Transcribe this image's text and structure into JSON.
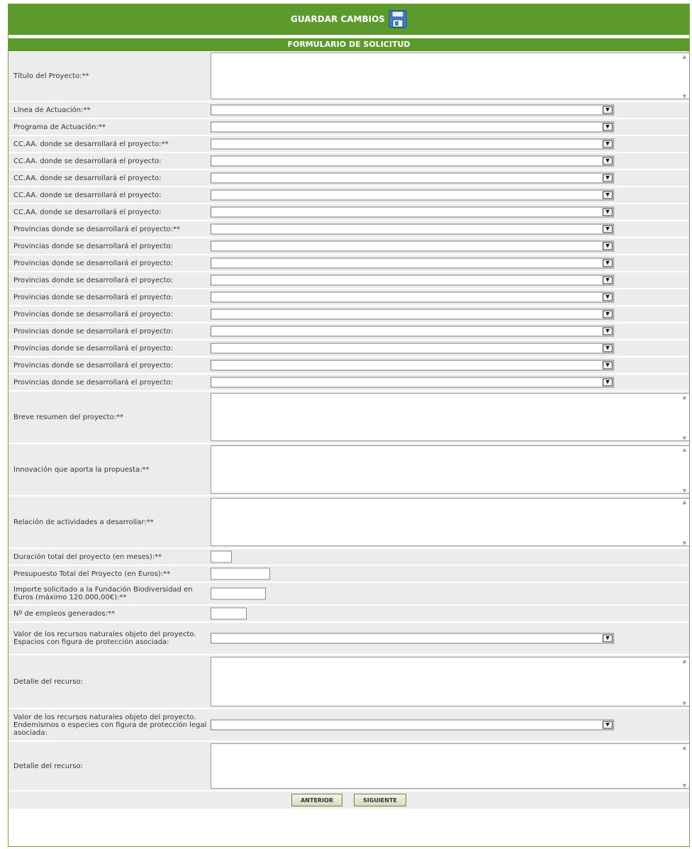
{
  "toolbar": {
    "save_label": "GUARDAR CAMBIOS"
  },
  "form": {
    "title": "FORMULARIO DE SOLICITUD"
  },
  "rows": [
    {
      "type": "textarea",
      "label": "Título del Proyecto:**",
      "value": ""
    },
    {
      "type": "select",
      "label": "Línea de Actuación:**",
      "value": ""
    },
    {
      "type": "select",
      "label": "Programa de Actuación:**",
      "value": ""
    },
    {
      "type": "select",
      "label": "CC.AA. donde se desarrollará el proyecto:**",
      "value": ""
    },
    {
      "type": "select",
      "label": "CC.AA. donde se desarrollará el proyecto:",
      "value": ""
    },
    {
      "type": "select",
      "label": "CC.AA. donde se desarrollará el proyecto:",
      "value": ""
    },
    {
      "type": "select",
      "label": "CC.AA. donde se desarrollará el proyecto:",
      "value": ""
    },
    {
      "type": "select",
      "label": "CC.AA. donde se desarrollará el proyecto:",
      "value": ""
    },
    {
      "type": "select",
      "label": "Provincias donde se desarrollará el proyecto:**",
      "value": ""
    },
    {
      "type": "select",
      "label": "Provincias donde se desarrollará el proyecto:",
      "value": ""
    },
    {
      "type": "select",
      "label": "Provincias donde se desarrollará el proyecto:",
      "value": ""
    },
    {
      "type": "select",
      "label": "Provincias donde se desarrollará el proyecto:",
      "value": ""
    },
    {
      "type": "select",
      "label": "Provincias donde se desarrollará el proyecto:",
      "value": ""
    },
    {
      "type": "select",
      "label": "Provincias donde se desarrollará el proyecto:",
      "value": ""
    },
    {
      "type": "select",
      "label": "Provincias donde se desarrollará el proyecto:",
      "value": ""
    },
    {
      "type": "select",
      "label": "Provincias donde se desarrollará el proyecto:",
      "value": ""
    },
    {
      "type": "select",
      "label": "Provincias donde se desarrollará el proyecto:",
      "value": ""
    },
    {
      "type": "select",
      "label": "Provincias donde se desarrollará el proyecto:",
      "value": ""
    },
    {
      "type": "textarea",
      "label": "Breve resumen del proyecto:**",
      "value": ""
    },
    {
      "type": "textarea",
      "label": "Innovación que aporta la propuesta:**",
      "value": ""
    },
    {
      "type": "textarea",
      "label": "Relación de actividades a desarrollar:**",
      "value": ""
    },
    {
      "type": "input",
      "label": "Duración total del proyecto (en meses):**",
      "value": ""
    },
    {
      "type": "input",
      "label": "Presupuesto Total del Proyecto (en Euros):**",
      "value": ""
    },
    {
      "type": "input",
      "label": "Importe solicitado a la Fundación Biodiversidad en Euros (máximo 120.000,00€):**",
      "value": ""
    },
    {
      "type": "input",
      "label": "Nº de empleos generados:**",
      "value": ""
    },
    {
      "type": "select",
      "label": "Valor de los recursos naturales objeto del proyecto. Espacios con figura de protección asociada:",
      "value": ""
    },
    {
      "type": "textarea",
      "label": "Detalle del recurso:",
      "value": ""
    },
    {
      "type": "select",
      "label": "Valor de los recursos naturales objeto del proyecto. Endemismos o especies con figura de protección legal asociada:",
      "value": ""
    },
    {
      "type": "textarea",
      "label": "Detalle del recurso:",
      "value": ""
    }
  ],
  "buttons": {
    "prev_label": "ANTERIOR",
    "next_label": "SIGUIENTE"
  },
  "icons": {
    "save": "floppy-disk-icon",
    "select_arrow": "dropdown-arrow-icon",
    "scroll": "scroll-arrow-icon"
  },
  "colors": {
    "header_green": "#5c9a2e",
    "row_bg": "#ececec",
    "border": "#7aa05c"
  }
}
